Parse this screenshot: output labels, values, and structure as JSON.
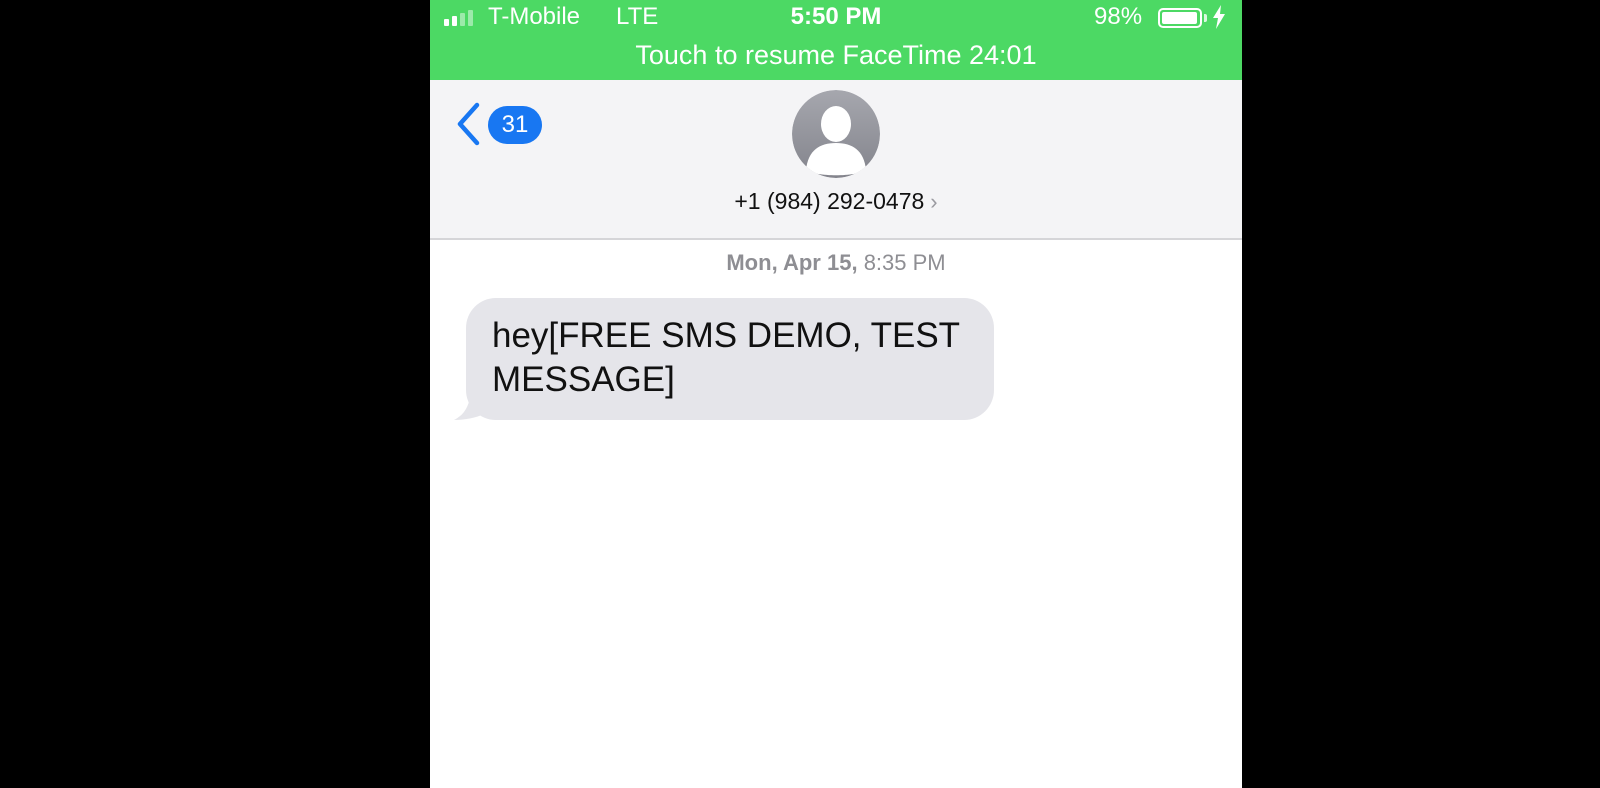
{
  "status_bar": {
    "carrier": "T-Mobile",
    "network": "LTE",
    "time": "5:50 PM",
    "battery_percent": "98%",
    "battery_level": 0.98
  },
  "banner": {
    "text": "Touch to resume FaceTime 24:01"
  },
  "header": {
    "back_badge": "31",
    "contact_number": "+1 (984) 292-0478",
    "contact_chevron": "›"
  },
  "conversation": {
    "timestamp_day": "Mon, Apr 15,",
    "timestamp_time": "8:35 PM",
    "messages": [
      {
        "direction": "incoming",
        "text": "hey[FREE SMS DEMO, TEST MESSAGE]"
      }
    ]
  },
  "colors": {
    "banner_green": "#4cd964",
    "badge_blue": "#1877f2",
    "incoming_bubble": "#e5e5ea",
    "background": "#000000"
  }
}
